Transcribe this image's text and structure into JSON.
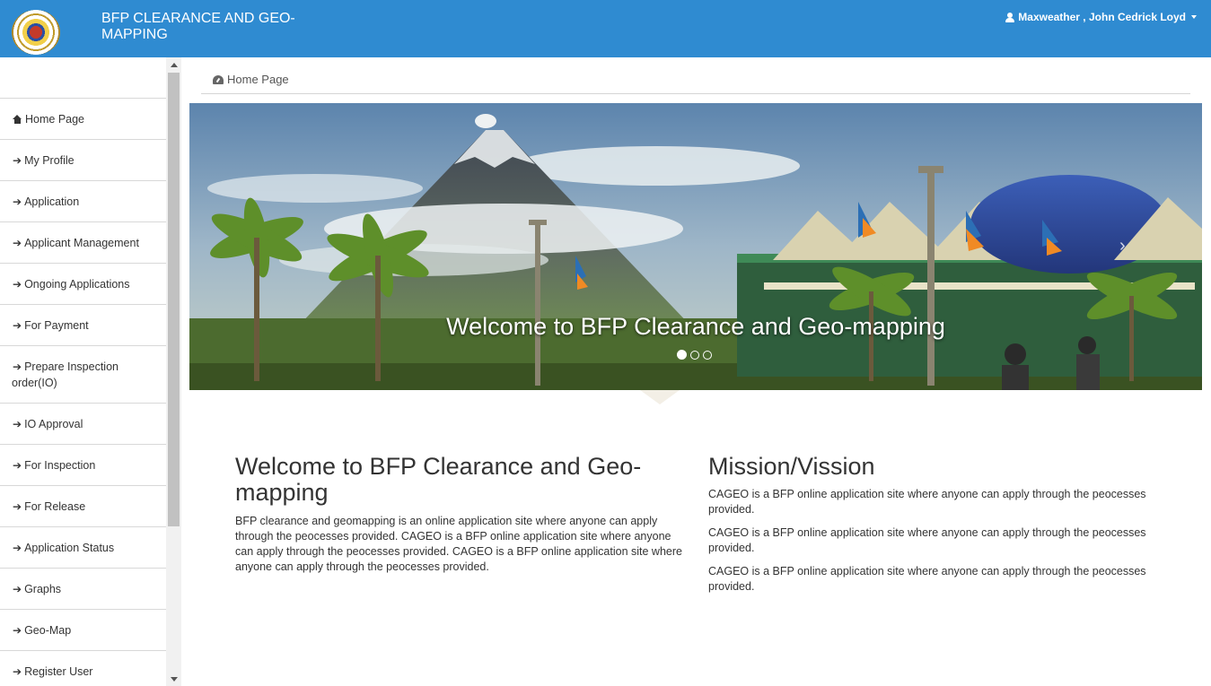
{
  "header": {
    "title": "BFP CLEARANCE AND GEO-MAPPING",
    "user_name": "Maxweather , John Cedrick Loyd",
    "brand_color": "#2f8bd1"
  },
  "sidebar": {
    "items": [
      {
        "label": "Home Page",
        "icon": "home-icon"
      },
      {
        "label": "My Profile",
        "icon": "arrow-right-icon"
      },
      {
        "label": "Application",
        "icon": "arrow-right-icon"
      },
      {
        "label": "Applicant Management",
        "icon": "arrow-right-icon"
      },
      {
        "label": "Ongoing Applications",
        "icon": "arrow-right-icon"
      },
      {
        "label": "For Payment",
        "icon": "arrow-right-icon"
      },
      {
        "label": "Prepare Inspection order(IO)",
        "icon": "arrow-right-icon"
      },
      {
        "label": "IO Approval",
        "icon": "arrow-right-icon"
      },
      {
        "label": "For Inspection",
        "icon": "arrow-right-icon"
      },
      {
        "label": "For Release",
        "icon": "arrow-right-icon"
      },
      {
        "label": "Application Status",
        "icon": "arrow-right-icon"
      },
      {
        "label": "Graphs",
        "icon": "arrow-right-icon"
      },
      {
        "label": "Geo-Map",
        "icon": "arrow-right-icon"
      },
      {
        "label": "Register User",
        "icon": "arrow-right-icon"
      }
    ]
  },
  "breadcrumb": {
    "label": "Home Page",
    "icon": "dashboard-icon"
  },
  "carousel": {
    "caption": "Welcome to BFP Clearance and Geo-mapping",
    "slide_count": 3,
    "active_slide": 1
  },
  "welcome": {
    "heading": "Welcome to BFP Clearance and Geo-mapping",
    "text": "BFP clearance and geomapping is an online application site where anyone can apply through the peocesses provided. CAGEO is a BFP online application site where anyone can apply through the peocesses provided. CAGEO is a BFP online application site where anyone can apply through the peocesses provided."
  },
  "mission": {
    "heading": "Mission/Vission",
    "paragraphs": [
      "CAGEO is a BFP online application site where anyone can apply through the peocesses provided.",
      "CAGEO is a BFP online application site where anyone can apply through the peocesses provided.",
      "CAGEO is a BFP online application site where anyone can apply through the peocesses provided."
    ]
  }
}
